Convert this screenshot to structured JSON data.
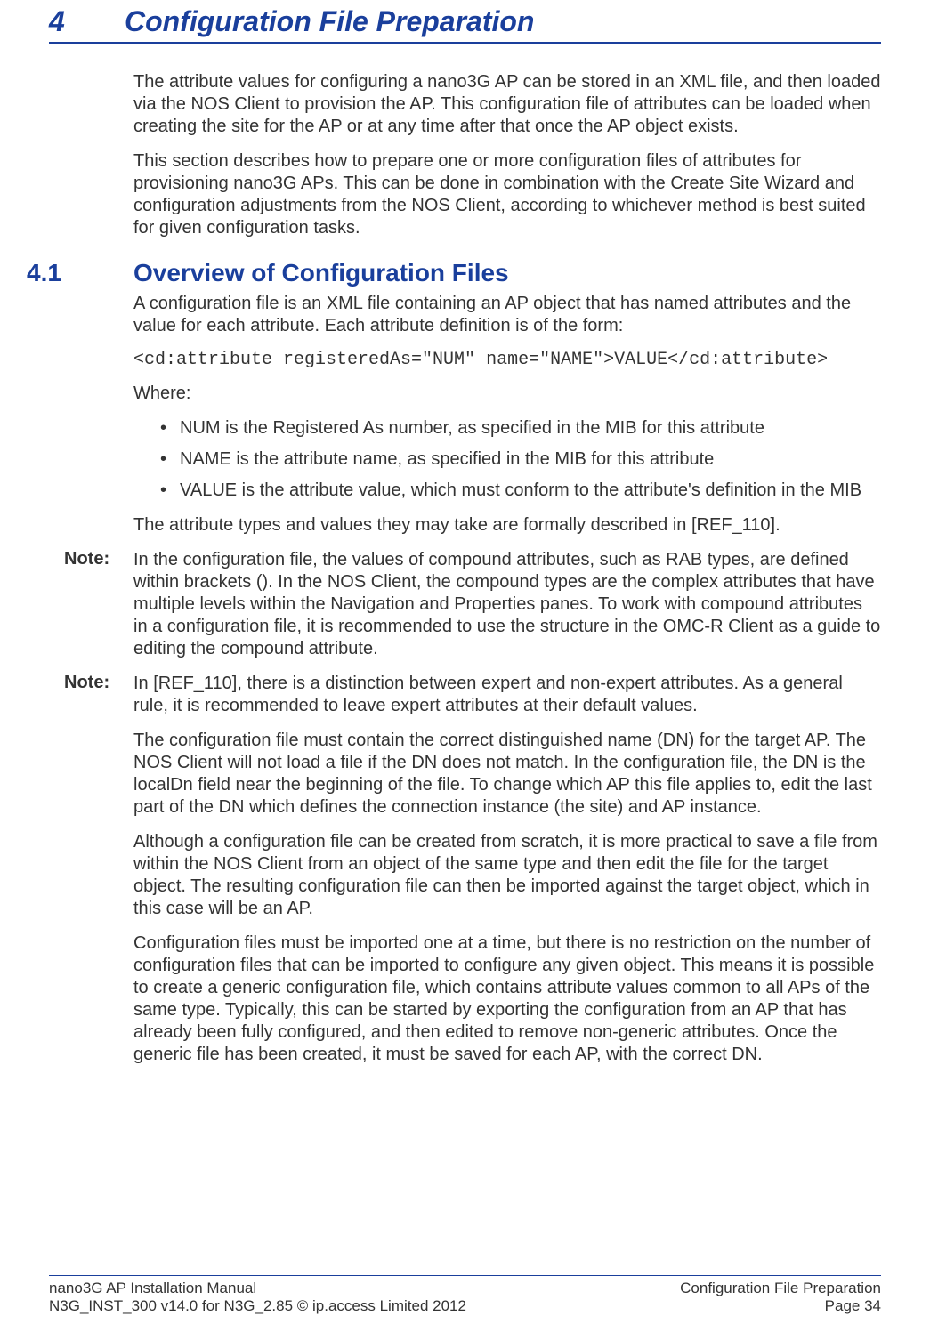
{
  "chapter": {
    "number": "4",
    "title": "Configuration File Preparation"
  },
  "intro": {
    "p1": "The attribute values for configuring a nano3G AP can be stored in an XML file, and then loaded via the NOS Client to provision the AP. This configuration file of attributes can be loaded when creating the site for the AP or at any time after that once the AP object exists.",
    "p2": "This section describes how to prepare one or more configuration files of attributes for provisioning nano3G APs. This can be done in combination with the Create Site Wizard and configuration adjustments from the NOS Client, according to whichever method is best suited for given configuration tasks."
  },
  "section41": {
    "number": "4.1",
    "title": "Overview of Configuration Files",
    "p1": "A configuration file is an XML file containing an AP object that has named attributes and the value for each attribute. Each attribute definition is of the form:",
    "code": "<cd:attribute registeredAs=\"NUM\" name=\"NAME\">VALUE</cd:attribute>",
    "where": "Where:",
    "bullets": [
      "NUM is the Registered As number, as specified in the MIB for this attribute",
      "NAME is the attribute name, as specified in the MIB for this attribute",
      "VALUE is the attribute value, which must conform to the attribute's definition in the MIB"
    ],
    "p2": "The attribute types and values they may take are formally described in [REF_110].",
    "note1_label": "Note:",
    "note1": "In the configuration file, the values of compound attributes, such as RAB types, are defined within brackets (). In the NOS Client, the compound types are the complex attributes that have multiple levels within the Navigation and Properties panes. To work with compound attributes in a configuration file, it is recommended to use the structure in the OMC-R Client as a guide to editing the compound attribute.",
    "note2_label": "Note:",
    "note2": "In [REF_110], there is a distinction between expert and non-expert attributes. As a general rule, it is recommended to leave expert attributes at their default values.",
    "p3": "The configuration file must contain the correct distinguished name (DN) for the target AP. The NOS Client will not load a file if the DN does not match. In the configuration file, the DN is the localDn field near the beginning of the file. To change which AP this file applies to, edit the last part of the DN which defines the connection instance (the site) and AP instance.",
    "p4": "Although a configuration file can be created from scratch, it is more practical to save a file from within the NOS Client from an object of the same type and then edit the file for the target object. The resulting configuration file can then be imported against the target object, which in this case will be an AP.",
    "p5": "Configuration files must be imported one at a time, but there is no restriction on the number of configuration files that can be imported to configure any given object. This means it is possible to create a generic configuration file, which contains attribute values common to all APs of the same type. Typically, this can be started by exporting the configuration from an AP that has already been fully configured, and then edited to remove non-generic attributes. Once the generic file has been created, it must be saved for each AP, with the correct DN."
  },
  "footer": {
    "left1": "nano3G AP Installation Manual",
    "left2": "N3G_INST_300 v14.0 for N3G_2.85 © ip.access Limited 2012",
    "right1": "Configuration File Preparation",
    "right2": "Page 34"
  }
}
